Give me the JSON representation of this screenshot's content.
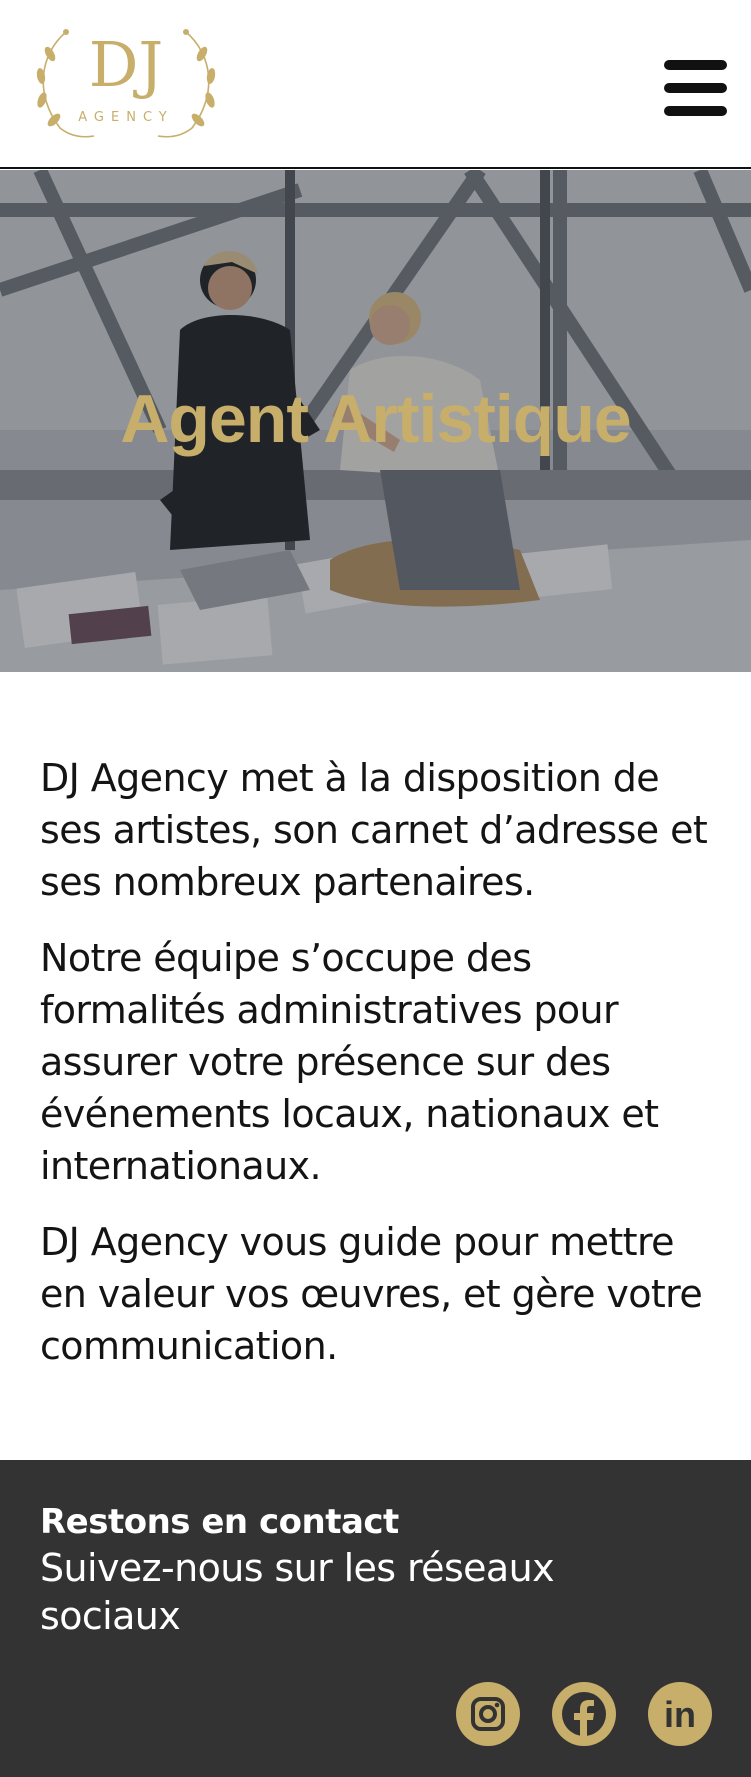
{
  "header": {
    "logo": {
      "monogram": "DJ",
      "wordmark": "AGENCY"
    },
    "menu_icon": "hamburger-menu-icon"
  },
  "hero": {
    "title": "Agent Artistique"
  },
  "content": {
    "paragraphs": [
      "DJ Agency met à la disposition de ses artistes, son carnet d’adresse et ses nombreux partenaires.",
      "Notre équipe s’occupe des formalités administratives pour assurer votre présence sur des événements locaux, nationaux et internationaux.",
      "DJ Agency vous guide pour mettre en valeur vos œuvres, et gère votre communication."
    ]
  },
  "footer": {
    "title": "Restons en contact",
    "subtitle": "Suivez-nous sur les réseaux sociaux",
    "social": [
      {
        "icon": "instagram-icon"
      },
      {
        "icon": "facebook-icon"
      },
      {
        "icon": "linkedin-icon",
        "label": "in"
      }
    ]
  },
  "colors": {
    "accent": "#c7ae6a",
    "footer_bg": "#333333",
    "text": "#141414"
  }
}
